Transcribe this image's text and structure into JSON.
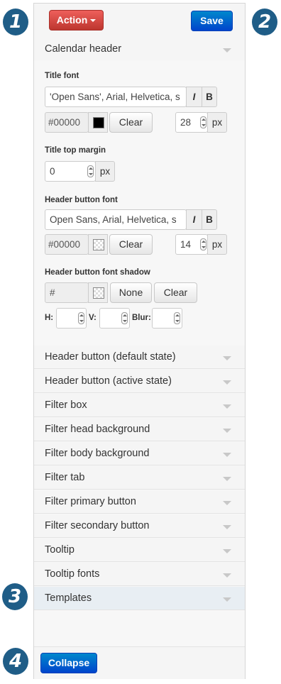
{
  "callouts": [
    "1",
    "2",
    "3",
    "4"
  ],
  "toolbar": {
    "action_label": "Action",
    "save_label": "Save"
  },
  "calendar_header": {
    "title": "Calendar header",
    "title_font": {
      "label": "Title font",
      "font_value": "'Open Sans', Arial, Helvetica, s",
      "italic": "I",
      "bold": "B",
      "color_value": "#00000",
      "color_swatch": "#000000",
      "clear": "Clear",
      "size_value": "28",
      "unit": "px"
    },
    "title_top_margin": {
      "label": "Title top margin",
      "value": "0",
      "unit": "px"
    },
    "header_button_font": {
      "label": "Header button font",
      "font_value": "Open Sans, Arial, Helvetica, s",
      "italic": "I",
      "bold": "B",
      "color_value": "#00000",
      "clear": "Clear",
      "size_value": "14",
      "unit": "px"
    },
    "header_button_font_shadow": {
      "label": "Header button font shadow",
      "color_value": "#",
      "none": "None",
      "clear": "Clear",
      "h_label": "H:",
      "v_label": "V:",
      "blur_label": "Blur:"
    }
  },
  "sections": [
    "Header button (default state)",
    "Header button (active state)",
    "Filter box",
    "Filter head background",
    "Filter body background",
    "Filter tab",
    "Filter primary button",
    "Filter secondary button",
    "Tooltip",
    "Tooltip fonts",
    "Templates"
  ],
  "footer": {
    "collapse_label": "Collapse"
  },
  "colors": {
    "accent": "#0055cc",
    "danger": "#da4f49",
    "callout": "#1f5d87"
  }
}
